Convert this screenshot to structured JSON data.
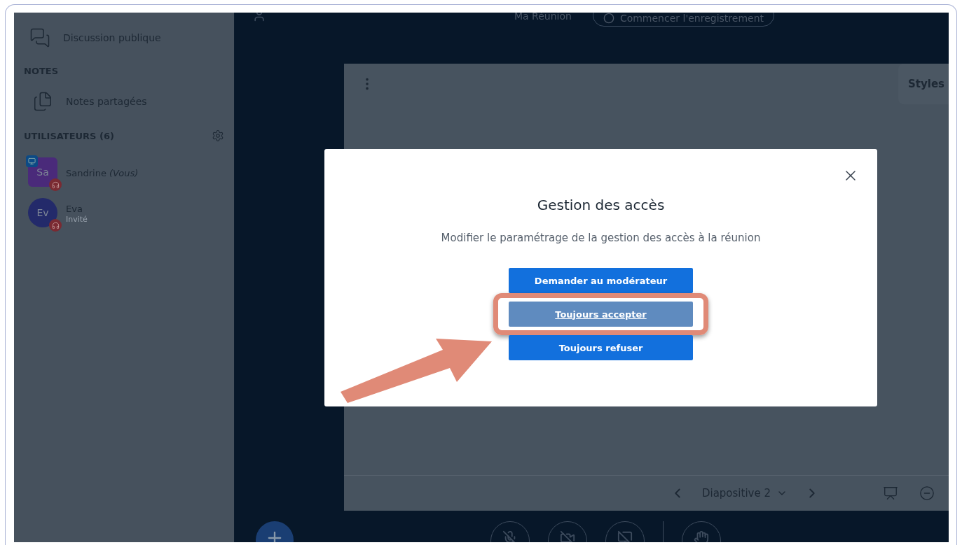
{
  "sidebar": {
    "chat": {
      "label": "Discussion publique"
    },
    "notes_heading": "NOTES",
    "notes": {
      "label": "Notes partagées"
    },
    "users_heading": "UTILISATEURS (6)",
    "users": [
      {
        "kind": "presenter",
        "initials": "Sa",
        "name": "Sandrine",
        "suffix": "(Vous)",
        "color": "#4a2a7a"
      },
      {
        "kind": "viewer",
        "initials": "Ev",
        "name": "Eva",
        "role": "Invité",
        "color": "#232a6a"
      }
    ]
  },
  "topbar": {
    "meeting_title": "Ma Réunion",
    "record_button": "Commencer l'enregistrement"
  },
  "presentation": {
    "styles_tab": "Styles",
    "slide_label": "Diapositive 2"
  },
  "modal": {
    "title": "Gestion des accès",
    "description": "Modifier le paramétrage de la gestion des accès à la réunion",
    "options": [
      {
        "label": "Demander au modérateur",
        "selected": false
      },
      {
        "label": "Toujours accepter",
        "selected": true
      },
      {
        "label": "Toujours refuser",
        "selected": false
      }
    ]
  }
}
